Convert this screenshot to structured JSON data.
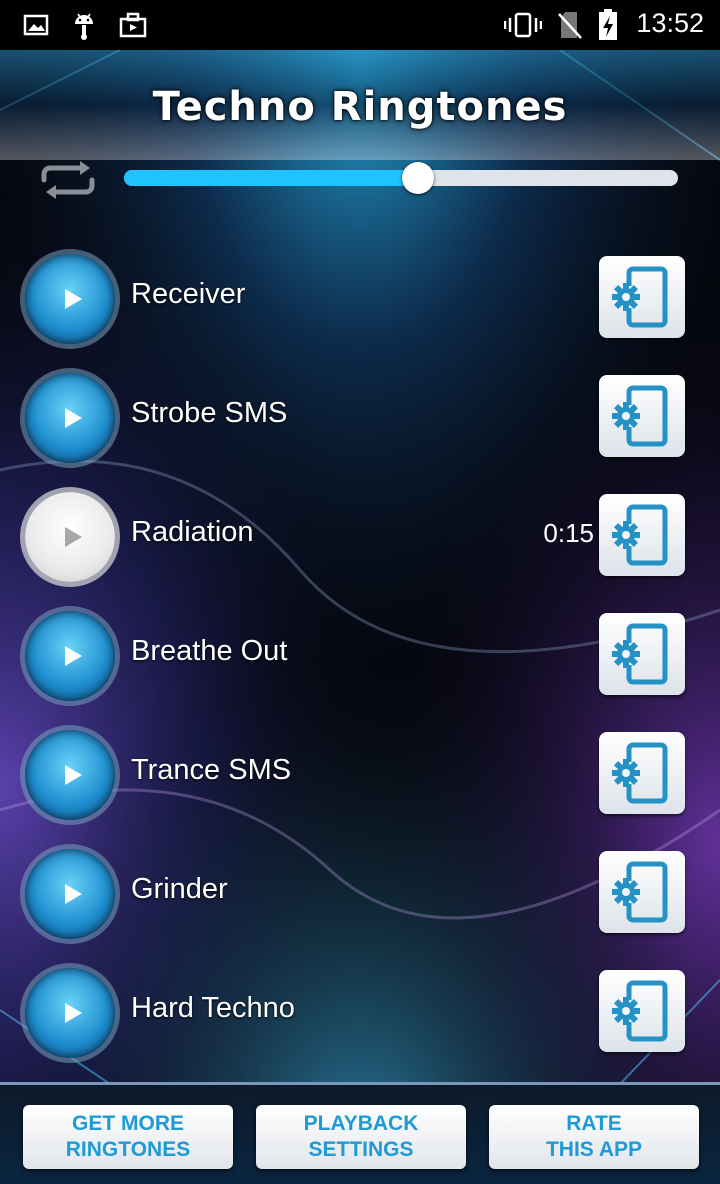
{
  "status_bar": {
    "time": "13:52",
    "left_icons": [
      "gallery-icon",
      "android-debug-icon",
      "briefcase-icon"
    ],
    "right_icons": [
      "vibrate-icon",
      "no-sim-icon",
      "battery-charging-icon"
    ]
  },
  "header": {
    "title": "Techno Ringtones"
  },
  "player": {
    "repeat_icon": "repeat-icon",
    "progress": 0.53
  },
  "ringtones": [
    {
      "name": "Receiver",
      "duration": "",
      "playing": false
    },
    {
      "name": "Strobe SMS",
      "duration": "",
      "playing": false
    },
    {
      "name": "Radiation",
      "duration": "0:15",
      "playing": true
    },
    {
      "name": "Breathe Out",
      "duration": "",
      "playing": false
    },
    {
      "name": "Trance SMS",
      "duration": "",
      "playing": false
    },
    {
      "name": "Grinder",
      "duration": "",
      "playing": false
    },
    {
      "name": "Hard Techno",
      "duration": "",
      "playing": false
    }
  ],
  "footer": {
    "get_more": [
      "GET MORE",
      "RINGTONES"
    ],
    "playback": [
      "PLAYBACK",
      "SETTINGS"
    ],
    "rate": [
      "RATE",
      "THIS APP"
    ]
  },
  "colors": {
    "accent": "#1fc3ff",
    "button_text": "#1f9ad6"
  }
}
